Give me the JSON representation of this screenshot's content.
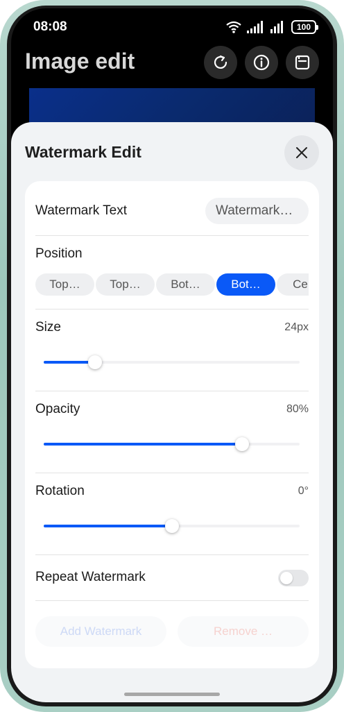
{
  "status_bar": {
    "time": "08:08",
    "battery": "100"
  },
  "app": {
    "title": "Image edit"
  },
  "header": {
    "icons": [
      "refresh-icon",
      "info-icon",
      "save-icon"
    ]
  },
  "sheet": {
    "title": "Watermark Edit",
    "close_icon": "close-icon",
    "watermark_text": {
      "label": "Watermark Text",
      "value": "Watermark…"
    },
    "position": {
      "label": "Position",
      "options": [
        "Top…",
        "Top…",
        "Bot…",
        "Bot…",
        "Ce…"
      ],
      "selected_index": 3
    },
    "size": {
      "label": "Size",
      "value_text": "24px",
      "fraction": 0.2
    },
    "opacity": {
      "label": "Opacity",
      "value_text": "80%",
      "fraction": 0.775
    },
    "rotation": {
      "label": "Rotation",
      "value_text": "0°",
      "fraction": 0.5
    },
    "repeat": {
      "label": "Repeat Watermark",
      "enabled": false
    },
    "buttons": {
      "add": "Add Watermark",
      "remove": "Remove …"
    }
  },
  "colors": {
    "accent": "#0a59f7",
    "sheet_bg": "#f1f3f5",
    "preview_blue": "#0a2f8a"
  }
}
